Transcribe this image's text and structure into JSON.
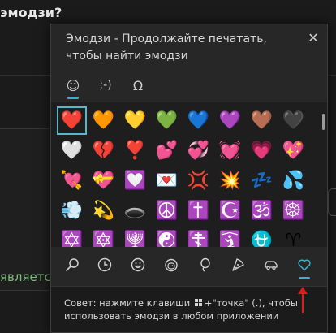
{
  "background": {
    "heading": "эмодзи?",
    "side_text": "является"
  },
  "panel": {
    "title": "Эмодзи - Продолжайте печатать, чтобы найти эмодзи",
    "close_glyph": "✕",
    "tabs": [
      {
        "label": "☺",
        "name": "tab-emoji",
        "active": true
      },
      {
        "label": ";-)",
        "name": "tab-kaomoji",
        "active": false
      },
      {
        "label": "Ω",
        "name": "tab-symbols",
        "active": false
      }
    ],
    "emoji_rows": [
      [
        "❤️",
        "🧡",
        "💛",
        "💚",
        "💙",
        "💜",
        "🤎",
        "🖤"
      ],
      [
        "🤍",
        "💔",
        "❣️",
        "💕",
        "💞",
        "💓",
        "💗",
        "💖"
      ],
      [
        "💘",
        "💝",
        "💟",
        "💌",
        "💢",
        "💥",
        "💤",
        "💦"
      ],
      [
        "💨",
        "💫",
        "🕳️",
        "☮️",
        "✝️",
        "☪️",
        "🕉️",
        "☸️"
      ],
      [
        "✡️",
        "🔯",
        "🕎",
        "☯️",
        "☦️",
        "🛐",
        "⛎",
        "♈"
      ]
    ],
    "categories": [
      {
        "name": "search-icon",
        "icon": "search"
      },
      {
        "name": "clock-icon",
        "icon": "clock"
      },
      {
        "name": "smiley-icon",
        "icon": "smiley"
      },
      {
        "name": "people-icon",
        "icon": "people"
      },
      {
        "name": "balloon-icon",
        "icon": "balloon"
      },
      {
        "name": "pizza-icon",
        "icon": "pizza"
      },
      {
        "name": "car-icon",
        "icon": "car"
      },
      {
        "name": "heart-icon",
        "icon": "heart",
        "active": true
      }
    ],
    "tip_before": "Совет: нажмите клавиши ",
    "tip_after": "+\"точка\" (.), чтобы использовать эмодзи в любом приложении"
  },
  "colors": {
    "accent": "#3db0c2",
    "arrow": "#e11b1b"
  }
}
